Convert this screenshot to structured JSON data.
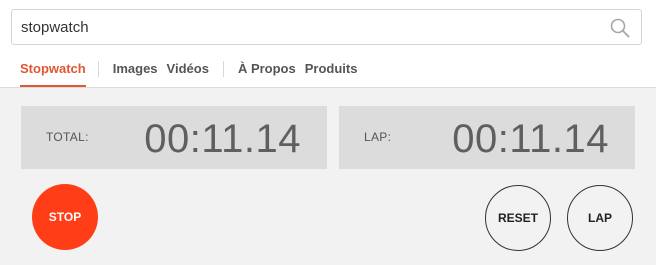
{
  "search": {
    "value": "stopwatch",
    "button_icon": "magnifier-icon"
  },
  "tabs": [
    {
      "label": "Stopwatch",
      "active": true
    },
    {
      "label": "Images"
    },
    {
      "label": "Vidéos"
    },
    {
      "label": "À Propos"
    },
    {
      "label": "Produits"
    }
  ],
  "stopwatch": {
    "total_label": "TOTAL:",
    "total_value": "00:11.14",
    "lap_label": "LAP:",
    "lap_value": "00:11.14",
    "stop_label": "STOP",
    "reset_label": "RESET",
    "lap_button_label": "LAP"
  },
  "colors": {
    "accent": "#de5833",
    "stop_button": "#ff3d16",
    "panel": "#dcdcdc",
    "module_bg": "#f2f2f2"
  }
}
